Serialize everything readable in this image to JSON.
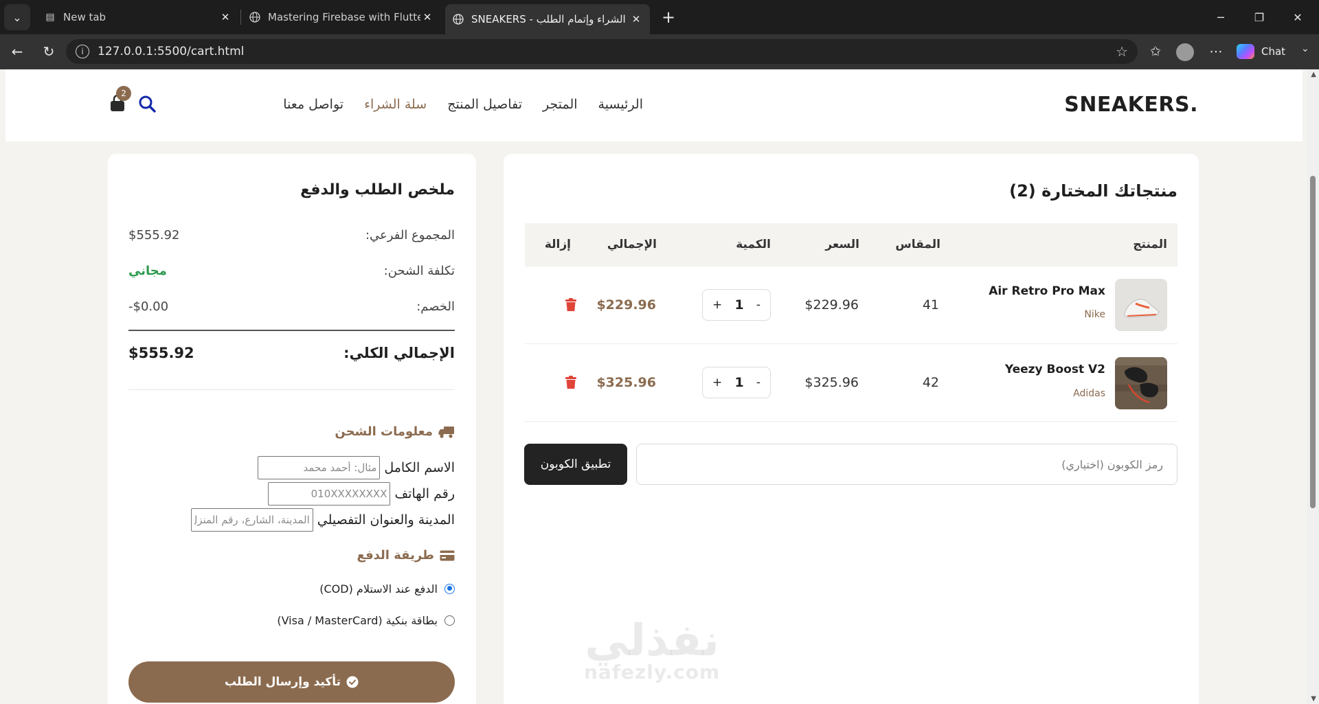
{
  "browser": {
    "tabs": [
      {
        "label": "New tab",
        "active": false
      },
      {
        "label": "Mastering Firebase with Flutter - In",
        "active": false
      },
      {
        "label": "SNEAKERS - سلة الشراء وإتمام الطلب",
        "active": true
      }
    ],
    "url": "127.0.0.1:5500/cart.html",
    "chat_label": "Chat"
  },
  "header": {
    "logo": "SNEAKERS.",
    "nav": [
      "الرئيسية",
      "المتجر",
      "تفاصيل المنتج",
      "سلة الشراء",
      "تواصل معنا"
    ],
    "active_nav": "سلة الشراء",
    "cart_count": "2"
  },
  "products": {
    "title": "منتجاتك المختارة (2)",
    "columns": {
      "product": "المنتج",
      "size": "المقاس",
      "price": "السعر",
      "quantity": "الكمية",
      "total": "الإجمالي",
      "remove": "إزالة"
    },
    "items": [
      {
        "name": "Air Retro Pro Max",
        "brand": "Nike",
        "size": "41",
        "price": "$229.96",
        "qty": "1",
        "total": "$229.96"
      },
      {
        "name": "Yeezy Boost V2",
        "brand": "Adidas",
        "size": "42",
        "price": "$325.96",
        "qty": "1",
        "total": "$325.96"
      }
    ],
    "coupon_placeholder": "رمز الكوبون (اختياري)",
    "coupon_button": "تطبيق الكوبون"
  },
  "summary": {
    "title": "ملخص الطلب والدفع",
    "subtotal_label": "المجموع الفرعي:",
    "subtotal": "$555.92",
    "shipping_label": "تكلفة الشحن:",
    "shipping": "مجاني",
    "discount_label": "الخصم:",
    "discount": "-$0.00",
    "grand_label": "الإجمالي الكلي:",
    "grand_total": "$555.92",
    "shipping_section": "معلومات الشحن",
    "name_label": "الاسم الكامل",
    "name_placeholder": "مثال: أحمد محمد",
    "phone_label": "رقم الهاتف",
    "phone_placeholder": "010XXXXXXXX",
    "address_label": "المدينة والعنوان التفصيلي",
    "address_placeholder": "المدينة، الشارع، رقم المنزل",
    "payment_section": "طريقة الدفع",
    "payment_options": [
      "الدفع عند الاستلام (COD)",
      "بطاقة بنكية (Visa / MasterCard)"
    ],
    "selected_payment": "الدفع عند الاستلام (COD)",
    "confirm_button": "تأكيد وإرسال الطلب"
  },
  "watermark": {
    "ar": "نفذلي",
    "en": "nafezly.com"
  },
  "colors": {
    "accent": "#8b6b4f",
    "free": "#2e9a4f",
    "danger": "#e0453a",
    "dark_button": "#232323"
  }
}
